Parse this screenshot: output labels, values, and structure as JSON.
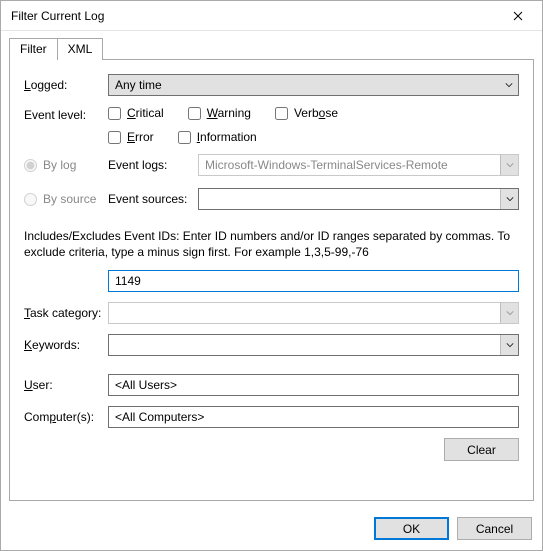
{
  "window": {
    "title": "Filter Current Log"
  },
  "tabs": {
    "filter": "Filter",
    "xml": "XML"
  },
  "labels": {
    "logged": "Logged:",
    "event_level": "Event level:",
    "by_log": "By log",
    "by_source": "By source",
    "event_logs": "Event logs:",
    "event_sources": "Event sources:",
    "task_category": "Task category:",
    "keywords": "Keywords:",
    "user": "User:",
    "computers": "Computer(s):"
  },
  "underline_text": {
    "logged": "L",
    "by_log_leading": "By ",
    "by_log_u": "l",
    "by_log_trailing": "og",
    "by_source_leading": "By ",
    "by_source_u": "s",
    "by_source_trailing": "ource",
    "task_leading": "",
    "task_u": "T",
    "task_trailing": "ask category:",
    "keywords_u": "K",
    "keywords_trailing": "eywords:",
    "user_u": "U",
    "user_trailing": "ser:",
    "computers_leading": "Com",
    "computers_u": "p",
    "computers_trailing": "uter(s):"
  },
  "logged": {
    "selected": "Any time"
  },
  "level": {
    "critical": "Critical",
    "warning": "Warning",
    "verbose": "Verbose",
    "error": "Error",
    "information": "Information"
  },
  "level_u": {
    "critical_trailing": "ritical",
    "warning_trailing": "arning",
    "verbose_leading": "Verb",
    "verbose_u": "o",
    "verbose_trailing": "se",
    "error_u": "E",
    "error_trailing": "rror",
    "information_u": "I",
    "information_trailing": "nformation"
  },
  "event_logs": {
    "selected": "Microsoft-Windows-TerminalServices-Remote"
  },
  "event_sources": {
    "selected": ""
  },
  "help": "Includes/Excludes Event IDs: Enter ID numbers and/or ID ranges separated by commas. To exclude criteria, type a minus sign first. For example 1,3,5-99,-76",
  "event_ids": {
    "value": "1149"
  },
  "task_category": {
    "selected": ""
  },
  "keywords": {
    "selected": ""
  },
  "user": {
    "value": "<All Users>"
  },
  "computers": {
    "value": "<All Computers>"
  },
  "buttons": {
    "clear": "Clear",
    "ok": "OK",
    "cancel": "Cancel"
  }
}
